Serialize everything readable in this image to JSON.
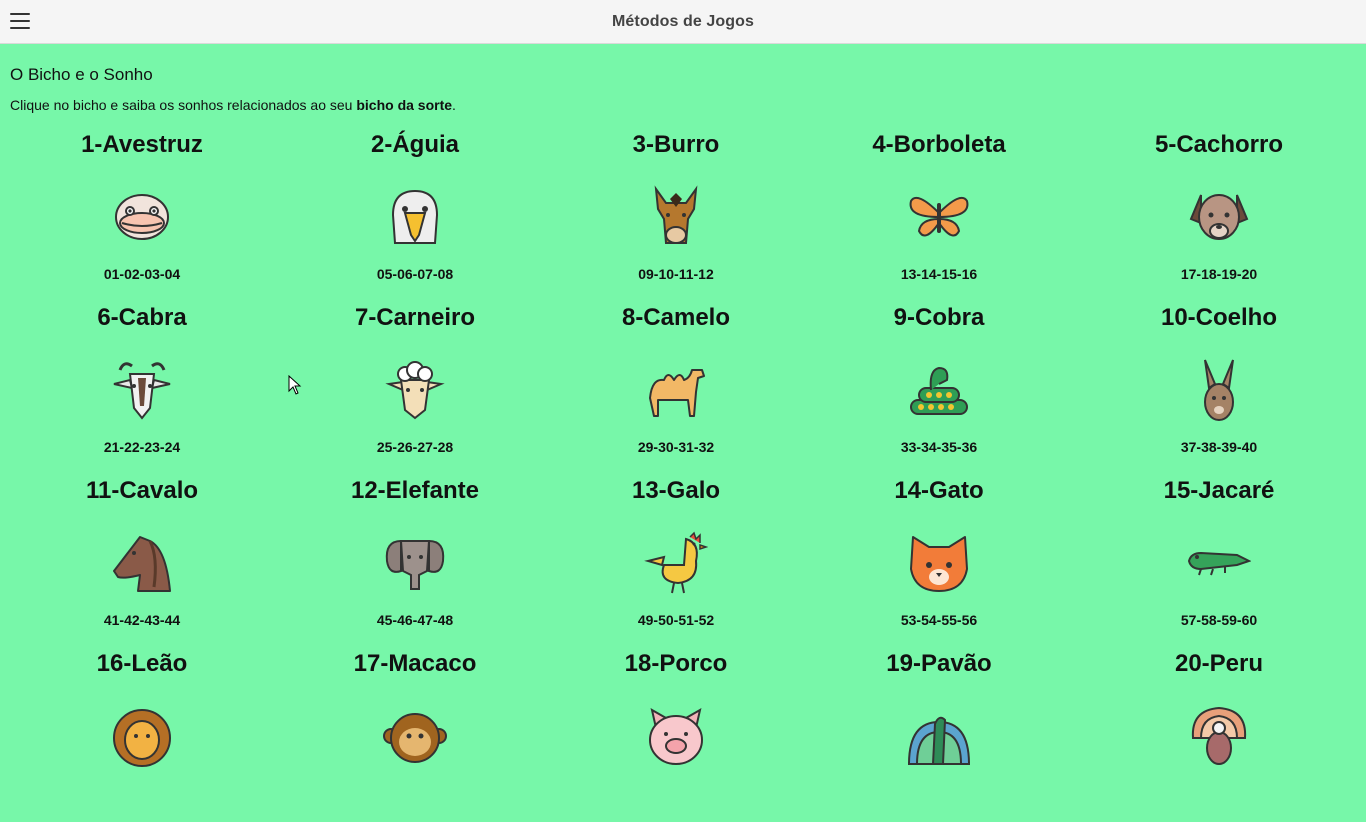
{
  "app": {
    "title": "Métodos de Jogos"
  },
  "section": {
    "title": "O Bicho e o Sonho",
    "intro_prefix": "Clique no bicho e saiba os sonhos relacionados ao seu ",
    "intro_bold": "bicho da sorte",
    "intro_suffix": "."
  },
  "animals": [
    {
      "name": "1-Avestruz",
      "numbers": "01-02-03-04",
      "icon": "ostrich-icon"
    },
    {
      "name": "2-Águia",
      "numbers": "05-06-07-08",
      "icon": "eagle-icon"
    },
    {
      "name": "3-Burro",
      "numbers": "09-10-11-12",
      "icon": "donkey-icon"
    },
    {
      "name": "4-Borboleta",
      "numbers": "13-14-15-16",
      "icon": "butterfly-icon"
    },
    {
      "name": "5-Cachorro",
      "numbers": "17-18-19-20",
      "icon": "dog-icon"
    },
    {
      "name": "6-Cabra",
      "numbers": "21-22-23-24",
      "icon": "goat-icon"
    },
    {
      "name": "7-Carneiro",
      "numbers": "25-26-27-28",
      "icon": "sheep-icon"
    },
    {
      "name": "8-Camelo",
      "numbers": "29-30-31-32",
      "icon": "camel-icon"
    },
    {
      "name": "9-Cobra",
      "numbers": "33-34-35-36",
      "icon": "snake-icon"
    },
    {
      "name": "10-Coelho",
      "numbers": "37-38-39-40",
      "icon": "rabbit-icon"
    },
    {
      "name": "11-Cavalo",
      "numbers": "41-42-43-44",
      "icon": "horse-icon"
    },
    {
      "name": "12-Elefante",
      "numbers": "45-46-47-48",
      "icon": "elephant-icon"
    },
    {
      "name": "13-Galo",
      "numbers": "49-50-51-52",
      "icon": "rooster-icon"
    },
    {
      "name": "14-Gato",
      "numbers": "53-54-55-56",
      "icon": "cat-icon"
    },
    {
      "name": "15-Jacaré",
      "numbers": "57-58-59-60",
      "icon": "alligator-icon"
    },
    {
      "name": "16-Leão",
      "numbers": "",
      "icon": "lion-icon"
    },
    {
      "name": "17-Macaco",
      "numbers": "",
      "icon": "monkey-icon"
    },
    {
      "name": "18-Porco",
      "numbers": "",
      "icon": "pig-icon"
    },
    {
      "name": "19-Pavão",
      "numbers": "",
      "icon": "peacock-icon"
    },
    {
      "name": "20-Peru",
      "numbers": "",
      "icon": "turkey-icon"
    }
  ]
}
